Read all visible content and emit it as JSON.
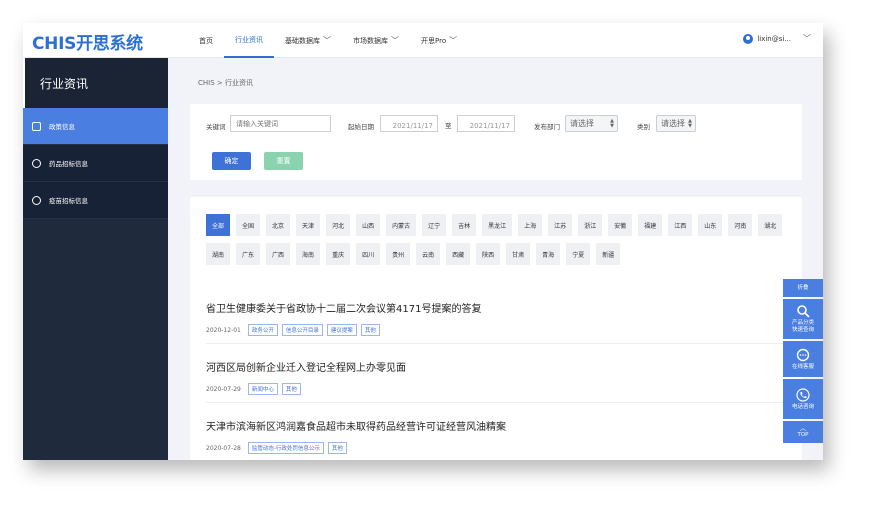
{
  "app": {
    "logo": "CHIS开思系统",
    "user": "lixin@si..."
  },
  "nav": [
    {
      "label": "首页",
      "active": false,
      "dropdown": false
    },
    {
      "label": "行业资讯",
      "active": true,
      "dropdown": false
    },
    {
      "label": "基础数据库",
      "active": false,
      "dropdown": true
    },
    {
      "label": "市场数据库",
      "active": false,
      "dropdown": true
    },
    {
      "label": "开思Pro",
      "active": false,
      "dropdown": true
    }
  ],
  "sidebar": {
    "title": "行业资讯",
    "items": [
      {
        "label": "政策信息",
        "active": true,
        "icon": "policy-icon"
      },
      {
        "label": "药品招标信息",
        "active": false,
        "icon": "drug-tender-icon"
      },
      {
        "label": "疫苗招标信息",
        "active": false,
        "icon": "vaccine-tender-icon"
      }
    ]
  },
  "breadcrumb": "CHIS > 行业资讯",
  "filter": {
    "keyword_label": "关键词",
    "keyword_placeholder": "请输入关键词",
    "start_date_label": "起始日期",
    "start_date": "2021/11/17",
    "to_label": "至",
    "end_date": "2021/11/17",
    "dept_label": "发布部门",
    "dept_value": "请选择",
    "category_label": "类别",
    "category_value": "请选择",
    "confirm_label": "确定",
    "reset_label": "重置"
  },
  "regions": [
    "全部",
    "全国",
    "北京",
    "天津",
    "河北",
    "山西",
    "内蒙古",
    "辽宁",
    "吉林",
    "黑龙江",
    "上海",
    "江苏",
    "浙江",
    "安徽",
    "福建",
    "江西",
    "山东",
    "河南",
    "湖北",
    "湖南",
    "广东",
    "广西",
    "海南",
    "重庆",
    "四川",
    "贵州",
    "云南",
    "西藏",
    "陕西",
    "甘肃",
    "青海",
    "宁夏",
    "新疆"
  ],
  "news": [
    {
      "title": "省卫生健康委关于省政协十二届二次会议第4171号提案的答复",
      "date": "2020-12-01",
      "tags": [
        "政务公开",
        "信息公开目录",
        "建议提案",
        "其他"
      ]
    },
    {
      "title": "河西区局创新企业迁入登记全程网上办零见面",
      "date": "2020-07-29",
      "tags": [
        "新闻中心",
        "其他"
      ]
    },
    {
      "title": "天津市滨海新区鸿润嘉食品超市未取得药品经营许可证经营风油精案",
      "date": "2020-07-28",
      "tags": [
        "监管动态-行政处罚信息公示",
        "其他"
      ]
    }
  ],
  "float_panel": {
    "collapse": "折叠",
    "search": "产品分类快速查询",
    "chat": "在线客服",
    "phone": "电话咨询",
    "top": "TOP"
  },
  "colors": {
    "primary": "#3f72d6",
    "sidebar": "#1f2a3c",
    "reset": "#8ad3ae"
  }
}
